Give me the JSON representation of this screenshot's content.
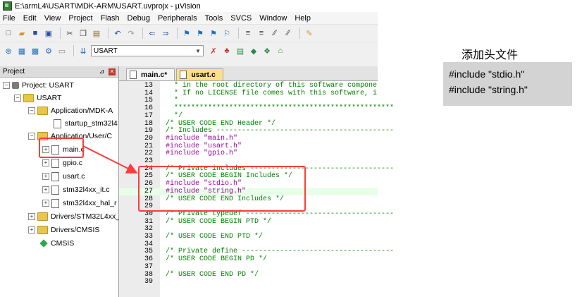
{
  "window": {
    "title": "E:\\armL4\\USART\\MDK-ARM\\USART.uvprojx - µVision"
  },
  "menu": [
    "File",
    "Edit",
    "View",
    "Project",
    "Flash",
    "Debug",
    "Peripherals",
    "Tools",
    "SVCS",
    "Window",
    "Help"
  ],
  "toolbar": {
    "target": "USART"
  },
  "project_panel": {
    "title": "Project",
    "nodes": [
      "Project: USART",
      "USART",
      "Application/MDK-A",
      "startup_stm32l4",
      "Application/User/C",
      "main.c",
      "gpio.c",
      "usart.c",
      "stm32l4xx_it.c",
      "stm32l4xx_hal_r",
      "Drivers/STM32L4xx_",
      "Drivers/CMSIS",
      "CMSIS"
    ]
  },
  "editor": {
    "tabs": [
      "main.c*",
      "usart.c"
    ],
    "lines": [
      {
        "n": "13",
        "t": "  * in the root directory of this software compone"
      },
      {
        "n": "14",
        "t": "  * If no LICENSE file comes with this software, i"
      },
      {
        "n": "15",
        "t": "  *"
      },
      {
        "n": "16",
        "t": "  ****************************************************"
      },
      {
        "n": "17",
        "t": "  */"
      },
      {
        "n": "18",
        "t": "/* USER CODE END Header */"
      },
      {
        "n": "19",
        "t": "/* Includes ------------------------------------------"
      },
      {
        "n": "20",
        "t": "#include \"main.h\""
      },
      {
        "n": "21",
        "t": "#include \"usart.h\""
      },
      {
        "n": "22",
        "t": "#include \"gpio.h\""
      },
      {
        "n": "23",
        "t": ""
      },
      {
        "n": "24",
        "t": "/* Private includes ----------------------------------"
      },
      {
        "n": "25",
        "t": "/* USER CODE BEGIN Includes */"
      },
      {
        "n": "26",
        "t": "#include \"stdio.h\""
      },
      {
        "n": "27",
        "t": "#include \"string.h\""
      },
      {
        "n": "28",
        "t": "/* USER CODE END Includes */"
      },
      {
        "n": "29",
        "t": ""
      },
      {
        "n": "30",
        "t": "/* Private typedef -----------------------------------"
      },
      {
        "n": "31",
        "t": "/* USER CODE BEGIN PTD */"
      },
      {
        "n": "32",
        "t": ""
      },
      {
        "n": "33",
        "t": "/* USER CODE END PTD */"
      },
      {
        "n": "34",
        "t": ""
      },
      {
        "n": "35",
        "t": "/* Private define ------------------------------------"
      },
      {
        "n": "36",
        "t": "/* USER CODE BEGIN PD */"
      },
      {
        "n": "37",
        "t": ""
      },
      {
        "n": "38",
        "t": "/* USER CODE END PD */"
      },
      {
        "n": "39",
        "t": ""
      }
    ]
  },
  "annotation": {
    "title": "添加头文件",
    "lines": [
      "#include \"stdio.h\"",
      "#include \"string.h\""
    ]
  }
}
